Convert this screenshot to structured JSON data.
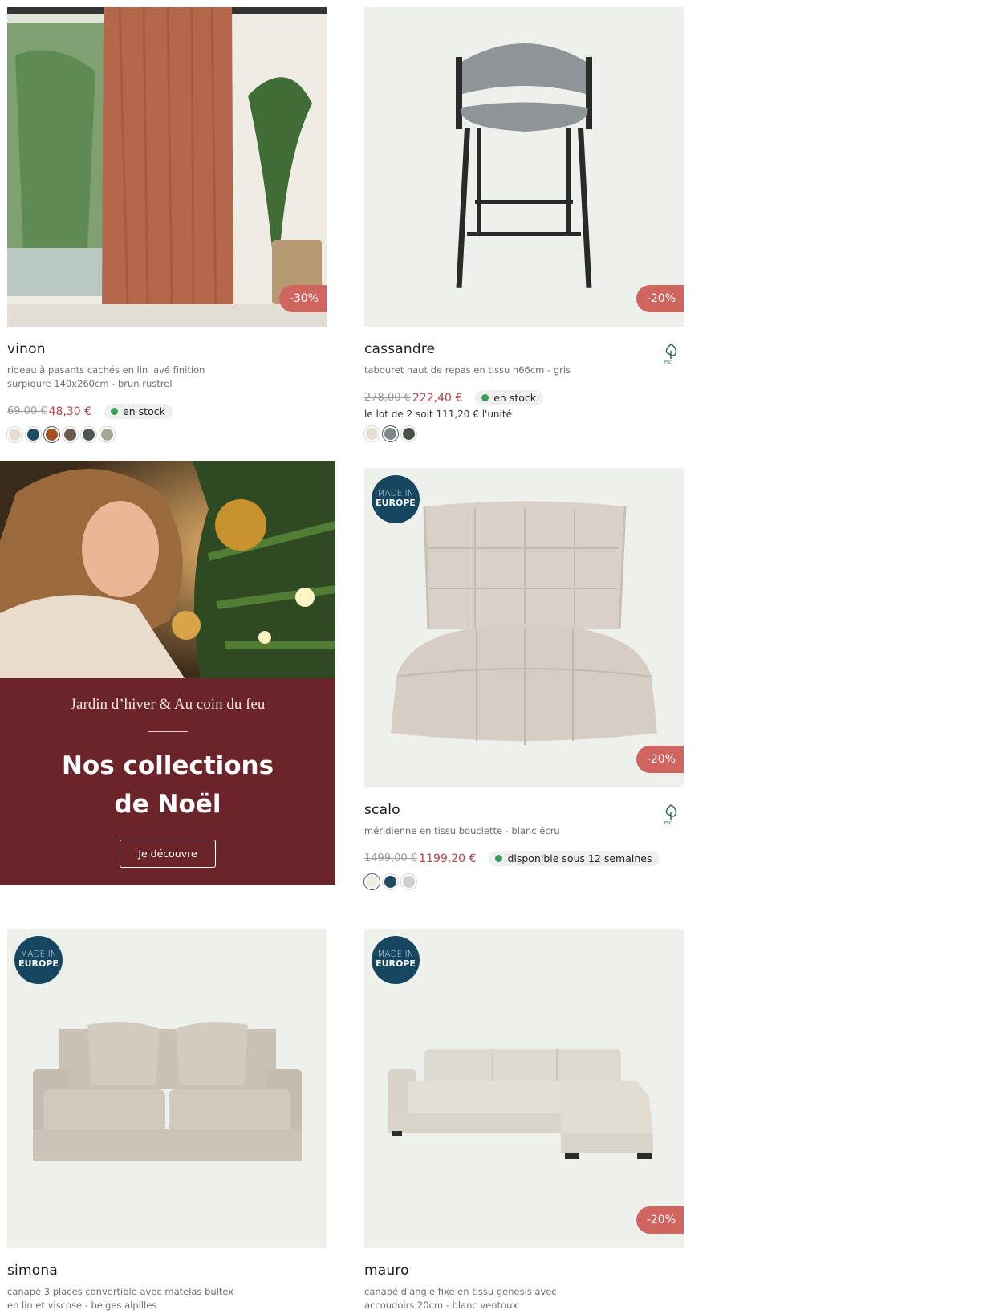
{
  "products": [
    {
      "name": "vinon",
      "desc": "rideau à pasants cachés en lin lavé finition surpiqure 140x260cm - brun rustrel",
      "old_price": "69,00 €",
      "new_price": "48,30 €",
      "stock": "en stock",
      "discount": "-30%",
      "swatches": [
        "#e6ddd1",
        "#1f4c63",
        "#a4501f",
        "#6b5b4e",
        "#505650",
        "#a3a797"
      ]
    },
    {
      "name": "cassandre",
      "desc": "tabouret haut de repas en tissu h66cm - gris",
      "old_price": "278,00 €",
      "new_price": "222,40 €",
      "stock": "en stock",
      "lot": "le lot de 2 soit 111,20 € l'unité",
      "discount": "-20%",
      "fsc": "FSC",
      "swatches": [
        "#e6ddd1",
        "#7f868a",
        "#4a5048"
      ]
    },
    {
      "name": "scalo",
      "desc": "méridienne en tissu bouclette - blanc écru",
      "old_price": "1499,00 €",
      "new_price": "1199,20 €",
      "stock": "disponible sous 12 semaines",
      "discount": "-20%",
      "fsc": "FSC",
      "badge_line1": "MADE IN",
      "badge_line2": "EUROPE",
      "swatches": [
        "#f3ece0",
        "#1f4c63",
        "#cfcfcf"
      ]
    },
    {
      "name": "simona",
      "desc": "canapé 3 places convertible avec matelas bultex en lin et viscose - beiges alpilles",
      "badge_line1": "MADE IN",
      "badge_line2": "EUROPE"
    },
    {
      "name": "mauro",
      "desc": "canapé d'angle fixe en tissu genesis avec accoudoirs 20cm - blanc ventoux",
      "discount": "-20%",
      "badge_line1": "MADE IN",
      "badge_line2": "EUROPE"
    }
  ],
  "banner": {
    "subtitle": "Jardin d’hiver & Au coin du feu",
    "title_line1": "Nos collections",
    "title_line2": "de Noël",
    "cta": "Je découvre"
  }
}
